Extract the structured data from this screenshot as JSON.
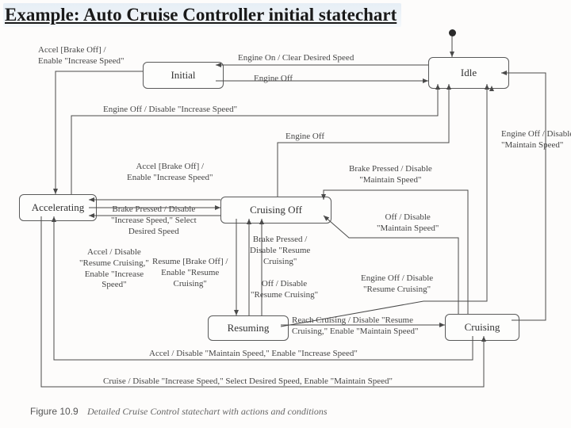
{
  "title": "Example: Auto Cruise Controller initial statechart",
  "caption_lead": "Figure 10.9",
  "caption_body": "Detailed Cruise Control statechart with actions and conditions",
  "nodes": {
    "initial": {
      "label": "Initial"
    },
    "idle": {
      "label": "Idle"
    },
    "accelerating": {
      "label": "Accelerating"
    },
    "cruising_off": {
      "label": "Cruising Off"
    },
    "resuming": {
      "label": "Resuming"
    },
    "cruising": {
      "label": "Cruising"
    }
  },
  "edges": {
    "idle_initial_top": "Engine On / Clear Desired Speed",
    "initial_idle_bot": "Engine Off",
    "initial_accel": "Accel [Brake Off] /\nEnable \"Increase Speed\"",
    "accel_idle": "Engine Off / Disable \"Increase Speed\"",
    "cruisingoff_idle": "Engine Off",
    "accel_cruisingoff_top": "Accel [Brake Off] /\nEnable \"Increase Speed\"",
    "accel_cruisingoff_mid": "Brake Pressed / Disable\n\"Increase Speed,\" Select\nDesired Speed",
    "cruisingoff_accel_btm": "Accel / Disable\n\"Resume Cruising,\"\nEnable \"Increase\nSpeed\"",
    "cruisingoff_resuming_top": "Resume [Brake Off] /\nEnable \"Resume\nCruising\"",
    "resuming_cruisingoff_mid": "Brake Pressed /\nDisable \"Resume\nCruising\"",
    "resuming_cruisingoff_btm": "Off / Disable\n\"Resume Cruising\"",
    "cruising_cruisingoff_top": "Brake Pressed / Disable\n\"Maintain Speed\"",
    "cruising_cruisingoff_btm": "Off / Disable\n\"Maintain Speed\"",
    "cruising_idle_right": "Engine Off / Disable\n\"Maintain Speed\"",
    "resuming_idle_right": "Engine Off / Disable\n\"Resume Cruising\"",
    "resuming_cruising": "Reach Cruising / Disable \"Resume\nCruising,\" Enable \"Maintain Speed\"",
    "cruising_accel": "Accel / Disable \"Maintain Speed,\" Enable \"Increase Speed\"",
    "accel_cruising": "Cruise / Disable \"Increase Speed,\" Select Desired Speed, Enable \"Maintain Speed\""
  }
}
